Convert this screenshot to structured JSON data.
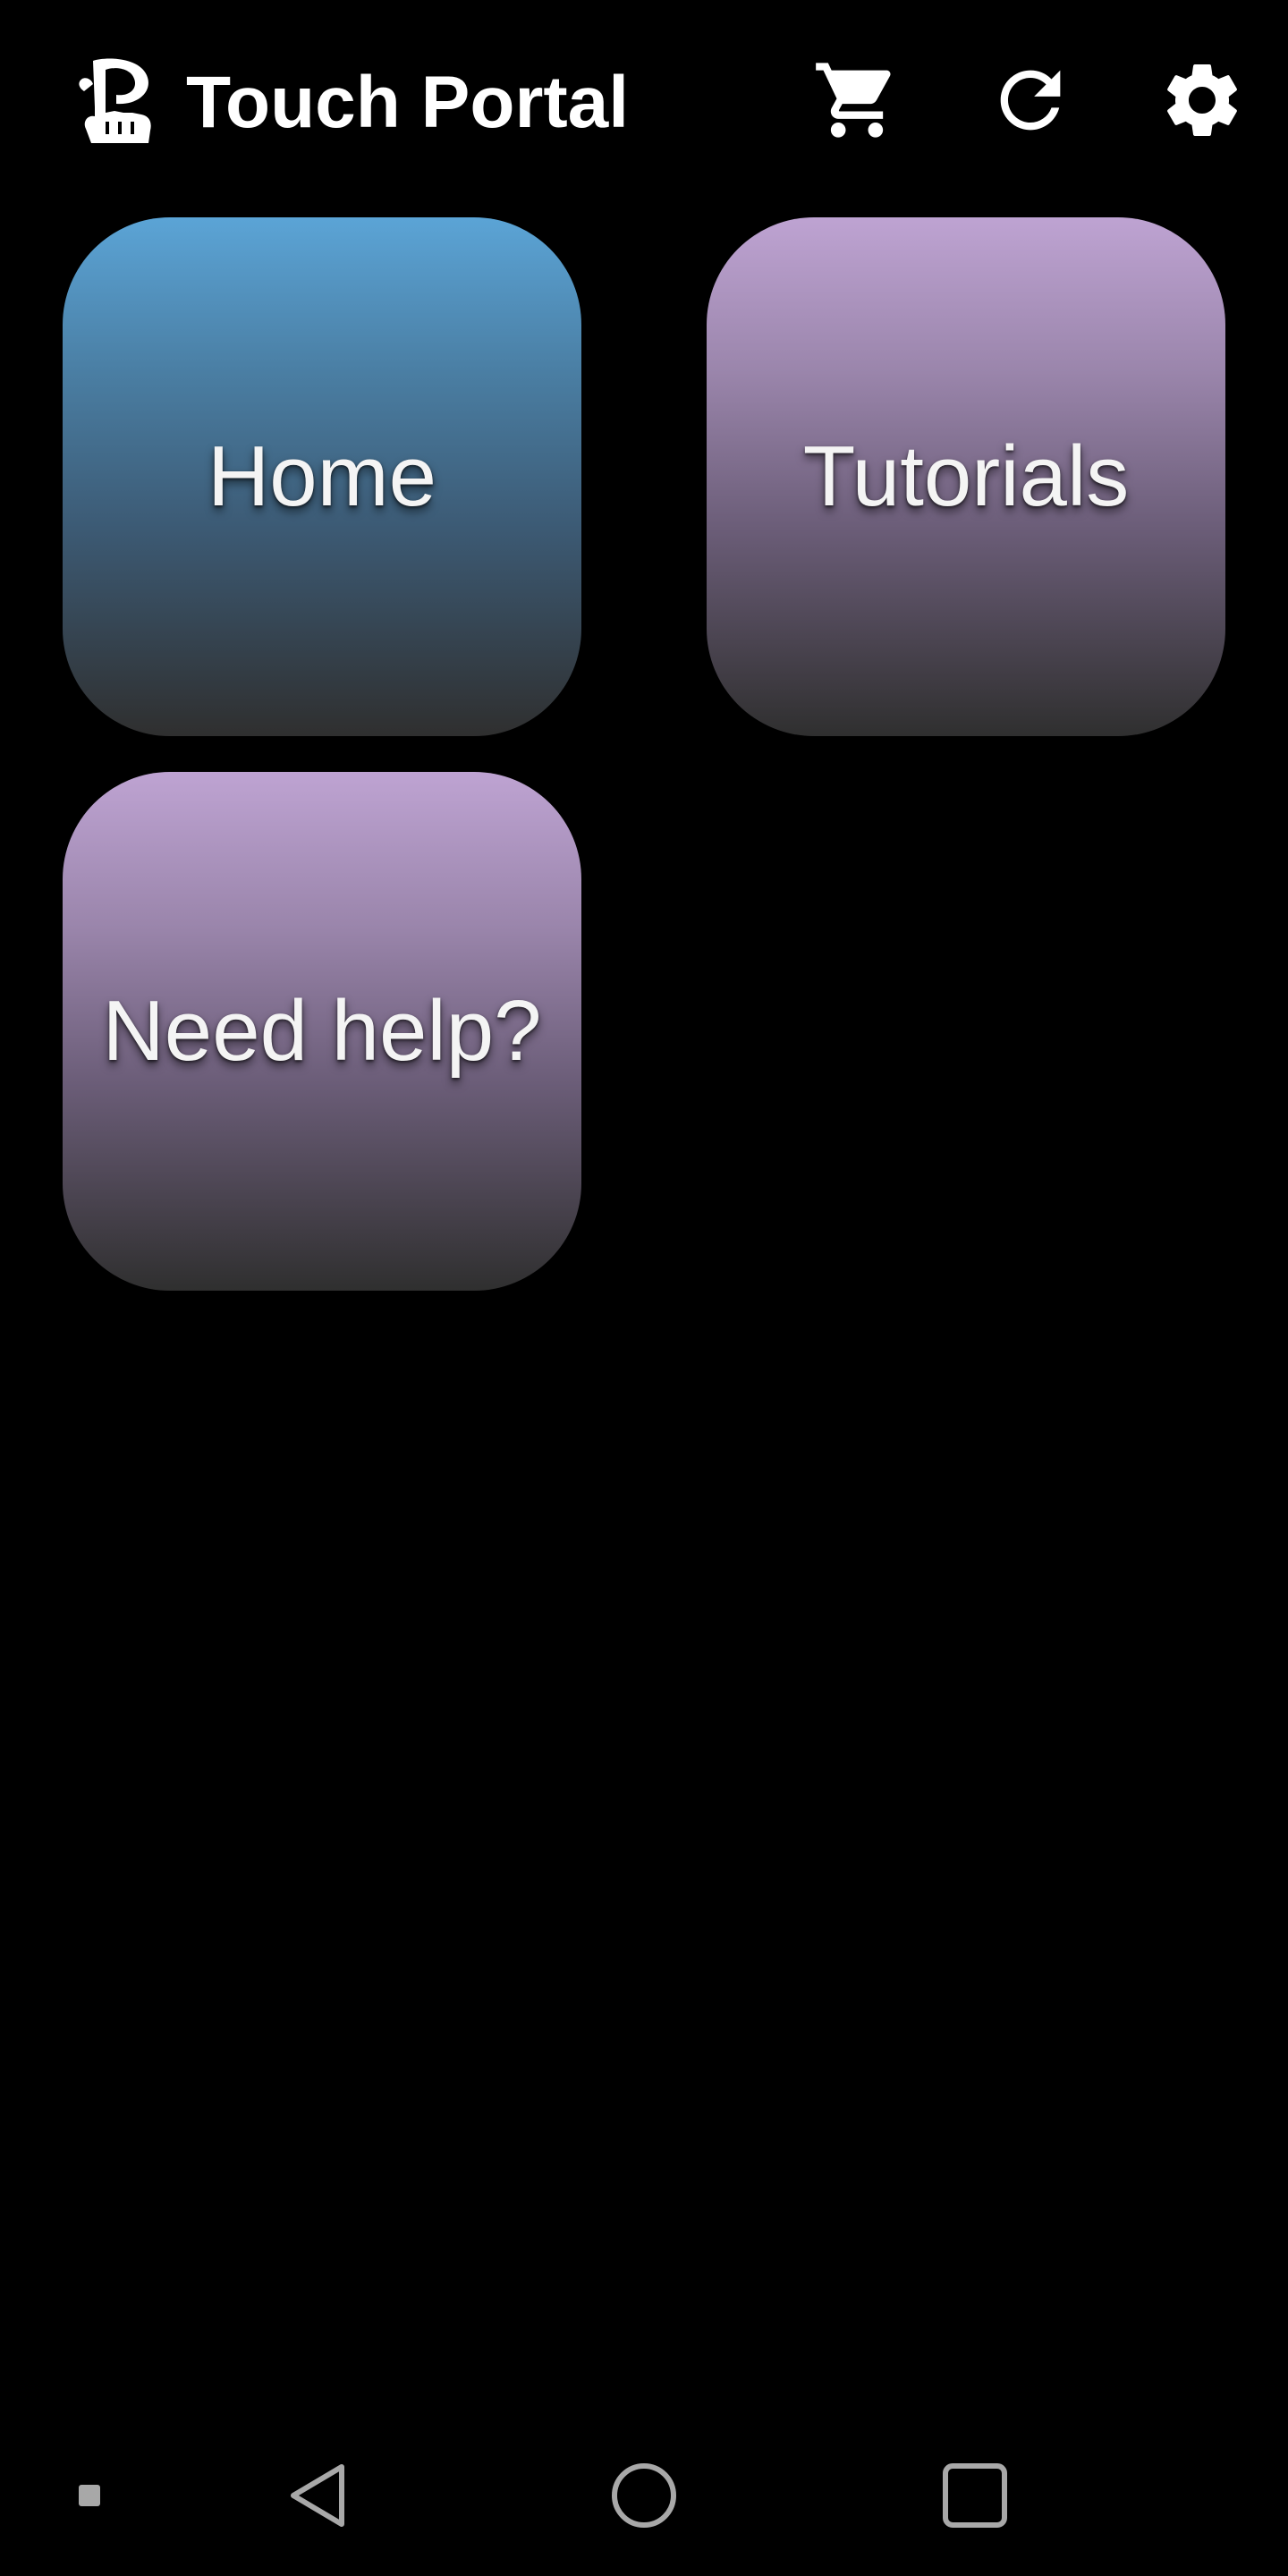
{
  "header": {
    "app_title": "Touch Portal",
    "logo_icon": "touch-portal-logo-icon",
    "buttons": [
      {
        "name": "cart-button",
        "icon": "cart-icon"
      },
      {
        "name": "refresh-button",
        "icon": "refresh-icon"
      },
      {
        "name": "settings-button",
        "icon": "gear-icon"
      }
    ]
  },
  "tiles": [
    {
      "label": "Home",
      "gradient_top": "#5ba4d6",
      "gradient_bottom": "#2f2f2f"
    },
    {
      "label": "Tutorials",
      "gradient_top": "#bea3d2",
      "gradient_bottom": "#2f2f2f"
    },
    {
      "label": "Need help?",
      "gradient_top": "#bea3d2",
      "gradient_bottom": "#2f2f2f"
    }
  ],
  "navbar": {
    "icons": [
      "square-dot-icon",
      "back-triangle-icon",
      "home-circle-icon",
      "recents-square-icon"
    ],
    "icon_color": "#a8a8a8"
  },
  "colors": {
    "background": "#000000",
    "text": "#ffffff"
  }
}
